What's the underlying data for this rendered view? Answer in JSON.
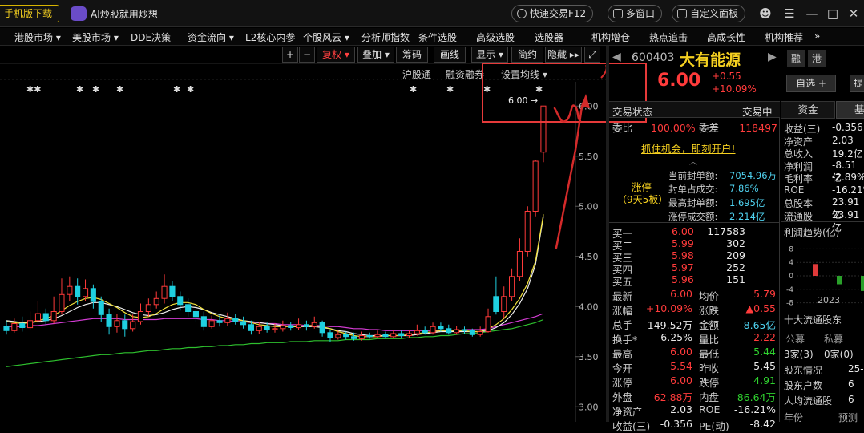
{
  "topbar": {
    "mobile_download": "手机版下载",
    "ai_label": "AI炒股就用炒想",
    "quick_trade": "快速交易F12",
    "multi_window": "多窗口",
    "custom_panel": "自定义面板"
  },
  "menu": {
    "items": [
      "港股市场",
      "美股市场",
      "DDE决策",
      "资金流向",
      "L2核心内参",
      "个股风云",
      "分析师指数",
      "条件选股",
      "高级选股",
      "选股器",
      "机构增仓",
      "热点追击",
      "高成长性",
      "机构推荐"
    ],
    "more": "»"
  },
  "chart_toolbar": {
    "plus": "+",
    "minus": "−",
    "fuquan": "复权",
    "diejia": "叠加",
    "chouma": "筹码",
    "huaxian": "画线",
    "xianshi": "显示",
    "jianyue": "简约",
    "yincang": "隐藏",
    "expand": "⤢"
  },
  "chart_labels": {
    "hugutong": "沪股通",
    "rongzirongquan": "融资融券",
    "set_ma": "设置均线",
    "max_label": "6.00 →",
    "stars": "** * * * ** * * * *"
  },
  "chart_data": {
    "type": "candlestick",
    "y_ticks": [
      "6.00",
      "5.50",
      "5.00",
      "4.50",
      "4.00",
      "3.50",
      "3.00"
    ],
    "ylim": [
      2.85,
      6.05
    ],
    "highest_price": 6.0,
    "candles": [
      [
        3.8,
        3.76,
        3.86,
        3.72
      ],
      [
        3.76,
        3.83,
        3.88,
        3.74
      ],
      [
        3.83,
        3.79,
        3.9,
        3.75
      ],
      [
        3.79,
        3.86,
        3.95,
        3.77
      ],
      [
        3.86,
        3.93,
        4.05,
        3.84
      ],
      [
        3.93,
        3.86,
        3.98,
        3.82
      ],
      [
        3.86,
        3.95,
        4.1,
        3.83
      ],
      [
        3.95,
        4.12,
        4.28,
        3.92
      ],
      [
        4.12,
        4.2,
        4.3,
        4.05
      ],
      [
        4.2,
        4.1,
        4.28,
        4.02
      ],
      [
        4.1,
        4.18,
        4.27,
        4.05
      ],
      [
        4.18,
        4.05,
        4.22,
        3.98
      ],
      [
        4.05,
        3.92,
        4.1,
        3.85
      ],
      [
        3.92,
        3.8,
        3.98,
        3.72
      ],
      [
        3.8,
        3.86,
        3.93,
        3.74
      ],
      [
        3.86,
        3.78,
        3.92,
        3.7
      ],
      [
        3.78,
        3.85,
        3.92,
        3.75
      ],
      [
        3.85,
        3.95,
        4.03,
        3.82
      ],
      [
        3.95,
        4.02,
        4.08,
        3.9
      ],
      [
        4.02,
        4.08,
        4.15,
        3.98
      ],
      [
        4.08,
        4.2,
        4.32,
        4.03
      ],
      [
        4.2,
        4.1,
        4.25,
        4.05
      ],
      [
        4.1,
        4.02,
        4.15,
        3.96
      ],
      [
        4.02,
        3.95,
        4.08,
        3.9
      ],
      [
        3.95,
        3.9,
        4.0,
        3.84
      ],
      [
        3.9,
        3.8,
        3.95,
        3.76
      ],
      [
        3.8,
        3.86,
        3.91,
        3.78
      ],
      [
        3.86,
        3.84,
        3.92,
        3.8
      ],
      [
        3.84,
        3.88,
        3.94,
        3.81
      ],
      [
        3.88,
        3.85,
        3.93,
        3.82
      ],
      [
        3.85,
        3.82,
        3.9,
        3.78
      ],
      [
        3.82,
        3.76,
        3.86,
        3.72
      ],
      [
        3.76,
        3.8,
        3.85,
        3.73
      ],
      [
        3.8,
        3.77,
        3.84,
        3.74
      ],
      [
        3.77,
        3.78,
        3.83,
        3.74
      ],
      [
        3.78,
        3.81,
        3.86,
        3.75
      ],
      [
        3.81,
        3.79,
        3.85,
        3.76
      ],
      [
        3.79,
        3.82,
        3.88,
        3.77
      ],
      [
        3.82,
        3.8,
        3.86,
        3.76
      ],
      [
        3.8,
        3.84,
        3.9,
        3.78
      ],
      [
        3.84,
        3.74,
        3.86,
        3.7
      ],
      [
        3.74,
        3.69,
        3.77,
        3.65
      ],
      [
        3.69,
        3.72,
        3.76,
        3.67
      ],
      [
        3.72,
        3.7,
        3.75,
        3.67
      ],
      [
        3.7,
        3.68,
        3.74,
        3.66
      ],
      [
        3.68,
        3.71,
        3.75,
        3.66
      ],
      [
        3.71,
        3.7,
        3.74,
        3.68
      ],
      [
        3.7,
        3.72,
        3.76,
        3.68
      ],
      [
        3.72,
        3.7,
        3.75,
        3.68
      ],
      [
        3.7,
        3.73,
        3.77,
        3.69
      ],
      [
        3.73,
        3.71,
        3.76,
        3.69
      ],
      [
        3.71,
        3.73,
        3.77,
        3.69
      ],
      [
        3.73,
        3.76,
        3.82,
        3.71
      ],
      [
        3.76,
        3.74,
        3.8,
        3.72
      ],
      [
        3.74,
        3.8,
        3.84,
        3.72
      ],
      [
        3.8,
        3.78,
        3.84,
        3.75
      ],
      [
        3.78,
        3.74,
        3.82,
        3.72
      ],
      [
        3.74,
        3.77,
        3.81,
        3.72
      ],
      [
        3.77,
        3.76,
        3.8,
        3.73
      ],
      [
        3.76,
        3.72,
        3.78,
        3.7
      ],
      [
        3.72,
        3.75,
        3.8,
        3.7
      ],
      [
        3.75,
        3.9,
        3.98,
        3.74
      ],
      [
        4.1,
        3.95,
        4.3,
        3.92
      ],
      [
        3.95,
        4.1,
        4.2,
        3.88
      ],
      [
        4.1,
        4.3,
        4.38,
        4.05
      ],
      [
        4.3,
        4.55,
        4.68,
        4.25
      ],
      [
        4.55,
        4.95,
        5.0,
        4.5
      ],
      [
        4.95,
        5.45,
        5.46,
        4.9
      ],
      [
        5.54,
        6.0,
        6.0,
        5.44
      ]
    ],
    "ma_yellow": [
      3.85,
      3.84,
      3.83,
      3.84,
      3.86,
      3.88,
      3.91,
      3.96,
      4.01,
      4.05,
      4.08,
      4.09,
      4.07,
      4.03,
      3.99,
      3.94,
      3.9,
      3.89,
      3.9,
      3.93,
      3.98,
      4.02,
      4.04,
      4.04,
      4.02,
      3.97,
      3.93,
      3.9,
      3.88,
      3.87,
      3.86,
      3.84,
      3.82,
      3.81,
      3.8,
      3.8,
      3.8,
      3.8,
      3.81,
      3.81,
      3.8,
      3.78,
      3.75,
      3.73,
      3.71,
      3.7,
      3.7,
      3.7,
      3.71,
      3.71,
      3.71,
      3.72,
      3.73,
      3.74,
      3.75,
      3.76,
      3.76,
      3.76,
      3.76,
      3.75,
      3.75,
      3.78,
      3.82,
      3.88,
      3.97,
      4.08,
      4.23,
      4.45,
      4.92
    ],
    "ma_white": [
      3.86,
      3.85,
      3.84,
      3.84,
      3.85,
      3.86,
      3.88,
      3.91,
      3.95,
      3.99,
      4.02,
      4.04,
      4.04,
      4.02,
      4.0,
      3.97,
      3.94,
      3.92,
      3.91,
      3.92,
      3.94,
      3.97,
      3.99,
      4.0,
      3.99,
      3.97,
      3.94,
      3.92,
      3.9,
      3.88,
      3.86,
      3.85,
      3.84,
      3.83,
      3.82,
      3.81,
      3.8,
      3.8,
      3.8,
      3.8,
      3.79,
      3.78,
      3.76,
      3.75,
      3.73,
      3.72,
      3.71,
      3.71,
      3.71,
      3.71,
      3.71,
      3.71,
      3.72,
      3.73,
      3.74,
      3.75,
      3.75,
      3.75,
      3.75,
      3.75,
      3.75,
      3.76,
      3.79,
      3.84,
      3.92,
      4.03,
      4.18,
      4.42,
      4.9
    ],
    "ma_magenta": [
      3.8,
      3.8,
      3.8,
      3.81,
      3.81,
      3.82,
      3.83,
      3.84,
      3.85,
      3.86,
      3.87,
      3.88,
      3.88,
      3.88,
      3.88,
      3.87,
      3.87,
      3.87,
      3.87,
      3.87,
      3.88,
      3.88,
      3.88,
      3.88,
      3.88,
      3.87,
      3.87,
      3.86,
      3.86,
      3.85,
      3.85,
      3.84,
      3.84,
      3.83,
      3.83,
      3.82,
      3.82,
      3.82,
      3.81,
      3.81,
      3.81,
      3.8,
      3.8,
      3.79,
      3.78,
      3.78,
      3.77,
      3.77,
      3.76,
      3.76,
      3.76,
      3.76,
      3.76,
      3.76,
      3.76,
      3.76,
      3.76,
      3.76,
      3.77,
      3.77,
      3.77,
      3.78,
      3.8,
      3.82,
      3.84,
      3.86,
      3.88,
      3.9,
      3.93
    ],
    "ma_green": [
      3.4,
      3.41,
      3.42,
      3.43,
      3.44,
      3.45,
      3.46,
      3.47,
      3.48,
      3.49,
      3.5,
      3.51,
      3.52,
      3.52,
      3.53,
      3.54,
      3.54,
      3.55,
      3.56,
      3.56,
      3.57,
      3.58,
      3.58,
      3.59,
      3.59,
      3.6,
      3.6,
      3.61,
      3.61,
      3.62,
      3.62,
      3.63,
      3.63,
      3.64,
      3.64,
      3.64,
      3.65,
      3.65,
      3.65,
      3.66,
      3.66,
      3.66,
      3.66,
      3.67,
      3.67,
      3.67,
      3.67,
      3.68,
      3.68,
      3.68,
      3.68,
      3.69,
      3.69,
      3.7,
      3.7,
      3.71,
      3.71,
      3.72,
      3.73,
      3.73,
      3.74,
      3.75,
      3.76,
      3.77,
      3.78,
      3.8,
      3.82,
      3.84,
      3.87
    ]
  },
  "quote": {
    "code": "600403",
    "name": "大有能源",
    "rong": "融",
    "gang": "港",
    "price": "6.00",
    "change": "+0.55",
    "change_pct": "+10.09%",
    "zixuan": "自选 +",
    "tisi": "提"
  },
  "tabs": {
    "status_label": "交易状态",
    "status_value": "交易中",
    "zijin": "资金",
    "ji": "基"
  },
  "weibi": {
    "label1": "委比",
    "value1": "100.00%",
    "label2": "委差",
    "value2": "118497"
  },
  "promo": "抓住机会，即刻开户!",
  "limit_up": {
    "title": "涨停",
    "sub": "（9天5板）",
    "rows": [
      {
        "label": "当前封单额:",
        "value": "7054.96万"
      },
      {
        "label": "封单占成交:",
        "value": "7.86%"
      },
      {
        "label": "最高封单额:",
        "value": "1.695亿"
      },
      {
        "label": "涨停成交额:",
        "value": "2.214亿"
      }
    ]
  },
  "order_book": [
    {
      "label": "买一",
      "price": "6.00",
      "vol": "117583"
    },
    {
      "label": "买二",
      "price": "5.99",
      "vol": "302"
    },
    {
      "label": "买三",
      "price": "5.98",
      "vol": "209"
    },
    {
      "label": "买四",
      "price": "5.97",
      "vol": "252"
    },
    {
      "label": "买五",
      "price": "5.96",
      "vol": "151"
    }
  ],
  "stats": [
    {
      "l1": "最新",
      "v1": "6.00",
      "c1": "red",
      "l2": "均价",
      "v2": "5.79",
      "c2": "red"
    },
    {
      "l1": "涨幅",
      "v1": "+10.09%",
      "c1": "red",
      "l2": "涨跌",
      "v2": "▲0.55",
      "c2": "red"
    },
    {
      "l1": "总手",
      "v1": "149.52万",
      "c1": "wht",
      "l2": "金额",
      "v2": "8.65亿",
      "c2": "cyan"
    },
    {
      "l1": "换手*",
      "v1": "6.25%",
      "c1": "wht",
      "l2": "量比",
      "v2": "2.22",
      "c2": "red"
    },
    {
      "l1": "最高",
      "v1": "6.00",
      "c1": "red",
      "l2": "最低",
      "v2": "5.44",
      "c2": "grn"
    },
    {
      "l1": "今开",
      "v1": "5.54",
      "c1": "red",
      "l2": "昨收",
      "v2": "5.45",
      "c2": "wht"
    },
    {
      "l1": "涨停",
      "v1": "6.00",
      "c1": "red",
      "l2": "跌停",
      "v2": "4.91",
      "c2": "grn"
    },
    {
      "l1": "外盘",
      "v1": "62.88万",
      "c1": "red",
      "l2": "内盘",
      "v2": "86.64万",
      "c2": "grn"
    },
    {
      "l1": "净资产",
      "v1": "2.03",
      "c1": "wht",
      "l2": "ROE",
      "v2": "-16.21%",
      "c2": "wht"
    },
    {
      "l1": "收益(三)",
      "v1": "-0.356",
      "c1": "wht",
      "l2": "PE(动)",
      "v2": "-8.42",
      "c2": "wht"
    }
  ],
  "finance": [
    {
      "label": "收益(三)",
      "value": "-0.356"
    },
    {
      "label": "净资产",
      "value": "2.03"
    },
    {
      "label": "总收入",
      "value": "19.2亿"
    },
    {
      "label": "净利润",
      "value": "-8.51亿"
    },
    {
      "label": "毛利率",
      "value": "-2.89%"
    },
    {
      "label": "ROE",
      "value": "-16.21%"
    },
    {
      "label": "总股本",
      "value": "23.91亿"
    },
    {
      "label": "流通股",
      "value": "23.91亿"
    }
  ],
  "profit_trend": {
    "title": "利润趋势(亿)",
    "y_ticks": [
      "8",
      "4",
      "0",
      "-4",
      "-8"
    ],
    "year": "2023",
    "bars": [
      3.5,
      -2.5,
      -4.5
    ]
  },
  "shareholders": {
    "title": "十大流通股东",
    "gongmu": "公募",
    "simu": "私募",
    "gongmu_val": "3家(3)",
    "simu_val": "0家(0)",
    "rows": [
      {
        "label": "股东情况",
        "value": "25-"
      },
      {
        "label": "股东户数",
        "value": "6"
      },
      {
        "label": "人均流通股",
        "value": "6"
      }
    ],
    "year_label": "年份",
    "forecast": "预测"
  }
}
